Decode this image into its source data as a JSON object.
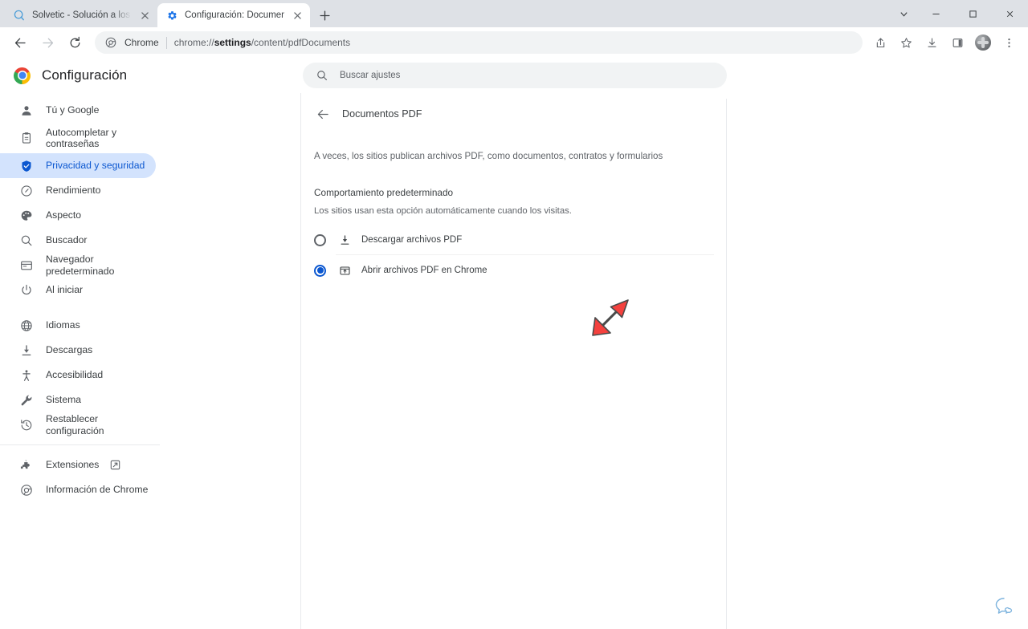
{
  "window": {
    "controls": {
      "tab_search_label": "Buscar pestañas",
      "minimize_label": "Minimizar",
      "maximize_label": "Maximizar",
      "close_label": "Cerrar"
    }
  },
  "tabs": [
    {
      "title": "Solvetic - Solución a los problem",
      "favicon": "solvetic-favicon",
      "active": false,
      "close_label": "×"
    },
    {
      "title": "Configuración: Documentos PDF",
      "favicon": "gear-favicon",
      "active": true,
      "close_label": "×"
    }
  ],
  "newtab": {
    "label": "+"
  },
  "toolbar": {
    "back_label": "←",
    "forward_label": "→",
    "reload_label": "⟳",
    "omnibox": {
      "chip": "Chrome",
      "url_prefix": "chrome://",
      "url_bold": "settings",
      "url_suffix": "/content/pdfDocuments",
      "full_url": "chrome://settings/content/pdfDocuments"
    },
    "icons": {
      "share": "share-icon",
      "bookmark": "star-icon",
      "downloads": "download-icon",
      "side_panel": "side-panel-icon",
      "profile": "avatar",
      "menu": "three-dot-menu-icon"
    }
  },
  "settings": {
    "brand_title": "Configuración",
    "search": {
      "placeholder": "Buscar ajustes",
      "value": ""
    },
    "sidebar": {
      "items": [
        {
          "label": "Tú y Google",
          "icon": "person-icon",
          "selected": false
        },
        {
          "label": "Autocompletar y contraseñas",
          "icon": "clipboard-icon",
          "selected": false
        },
        {
          "label": "Privacidad y seguridad",
          "icon": "shield-icon",
          "selected": true
        },
        {
          "label": "Rendimiento",
          "icon": "speedometer-icon",
          "selected": false
        },
        {
          "label": "Aspecto",
          "icon": "palette-icon",
          "selected": false
        },
        {
          "label": "Buscador",
          "icon": "search-icon",
          "selected": false
        },
        {
          "label": "Navegador predeterminado",
          "icon": "browser-window-icon",
          "selected": false
        },
        {
          "label": "Al iniciar",
          "icon": "power-icon",
          "selected": false
        }
      ],
      "items_group2": [
        {
          "label": "Idiomas",
          "icon": "globe-icon",
          "selected": false
        },
        {
          "label": "Descargas",
          "icon": "download-icon",
          "selected": false
        },
        {
          "label": "Accesibilidad",
          "icon": "accessibility-icon",
          "selected": false
        },
        {
          "label": "Sistema",
          "icon": "wrench-icon",
          "selected": false
        },
        {
          "label": "Restablecer configuración",
          "icon": "history-restore-icon",
          "selected": false
        }
      ],
      "items_group3": [
        {
          "label": "Extensiones",
          "icon": "puzzle-icon",
          "external": true,
          "selected": false
        },
        {
          "label": "Información de Chrome",
          "icon": "chrome-icon",
          "external": false,
          "selected": false
        }
      ]
    },
    "main": {
      "back_label": "←",
      "page_title": "Documentos PDF",
      "description": "A veces, los sitios publican archivos PDF, como documentos, contratos y formularios",
      "section_title": "Comportamiento predeterminado",
      "section_subtitle": "Los sitios usan esta opción automáticamente cuando los visitas.",
      "options": [
        {
          "label": "Descargar archivos PDF",
          "icon": "download-icon",
          "checked": false
        },
        {
          "label": "Abrir archivos PDF en Chrome",
          "icon": "open-in-window-icon",
          "checked": true
        }
      ]
    }
  },
  "annotation": {
    "arrow_color": "#f4413e",
    "arrow_outline": "#4a4a4a",
    "points_to": "Abrir archivos PDF en Chrome"
  },
  "feedback": {
    "icon": "speech-bubble-icon",
    "color": "#7eb4de"
  },
  "colors": {
    "accent": "#0b57d0",
    "selected_bg": "#d3e3fd",
    "tabstrip_bg": "#dee1e6",
    "omnibox_bg": "#f1f3f4",
    "text_primary": "#202124",
    "text_secondary": "#5f6368"
  }
}
